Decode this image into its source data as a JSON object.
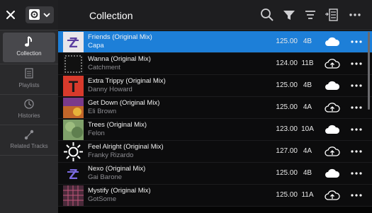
{
  "header": {
    "title": "Collection"
  },
  "rail": {
    "items": [
      {
        "label": "Collection",
        "icon": "music-note-icon"
      },
      {
        "label": "Playlists",
        "icon": "playlist-icon"
      },
      {
        "label": "Histories",
        "icon": "history-clock-icon"
      },
      {
        "label": "Related Tracks",
        "icon": "related-tracks-icon"
      }
    ]
  },
  "colors": {
    "accent": "#1d7fd8",
    "rail": "#2a2a2c",
    "background": "#0c0c0d"
  },
  "tracks": [
    {
      "name": "Friends (Original Mix)",
      "artist": "Capa",
      "bpm": "125.00",
      "key": "4B",
      "cloud": "cloud-synced-icon",
      "art": "art-purple-z"
    },
    {
      "name": "Wanna (Original Mix)",
      "artist": "Catchment",
      "bpm": "124.00",
      "key": "11B",
      "cloud": "cloud-upload-icon",
      "art": "art-dark-frame"
    },
    {
      "name": "Extra Trippy (Original Mix)",
      "artist": "Danny Howard",
      "bpm": "125.00",
      "key": "4B",
      "cloud": "cloud-synced-icon",
      "art": "art-red-t"
    },
    {
      "name": "Get Down (Original Mix)",
      "artist": "Eli Brown",
      "bpm": "125.00",
      "key": "4A",
      "cloud": "cloud-upload-icon",
      "art": "art-ibiza"
    },
    {
      "name": "Trees (Original Mix)",
      "artist": "Felon",
      "bpm": "123.00",
      "key": "10A",
      "cloud": "cloud-synced-icon",
      "art": "art-green"
    },
    {
      "name": "Feel Alright (Original Mix)",
      "artist": "Franky Rizardo",
      "bpm": "127.00",
      "key": "4A",
      "cloud": "cloud-upload-icon",
      "art": "art-sun"
    },
    {
      "name": "Nexo (Original Mix)",
      "artist": "Gai Barone",
      "bpm": "125.00",
      "key": "4B",
      "cloud": "cloud-synced-icon",
      "art": "art-dark-z"
    },
    {
      "name": "Mystify (Original Mix)",
      "artist": "GotSome",
      "bpm": "125.00",
      "key": "11A",
      "cloud": "cloud-upload-icon",
      "art": "art-grid"
    }
  ]
}
